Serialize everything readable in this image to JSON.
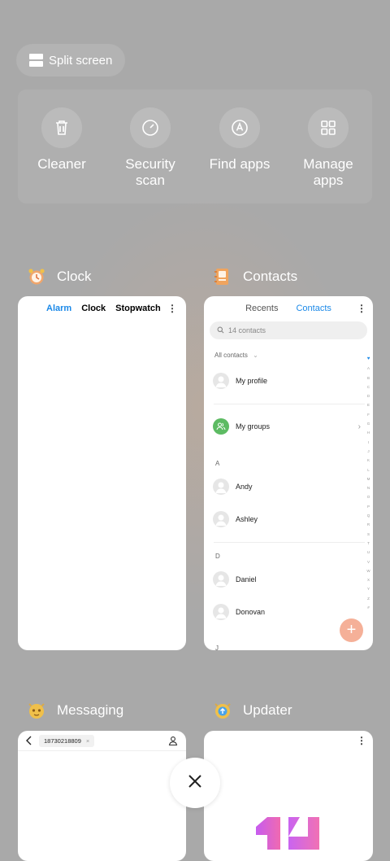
{
  "split_screen": {
    "label": "Split screen",
    "icon": "split-screen-icon"
  },
  "tools": [
    {
      "label": "Cleaner",
      "icon": "trash-icon"
    },
    {
      "label": "Security scan",
      "icon": "security-gauge-icon"
    },
    {
      "label": "Find apps",
      "icon": "find-apps-icon"
    },
    {
      "label": "Manage apps",
      "icon": "grid-icon"
    }
  ],
  "apps": {
    "clock": {
      "name": "Clock",
      "icon": "alarm-clock-icon",
      "tabs": [
        "Alarm",
        "Clock",
        "Stopwatch"
      ],
      "active_tab": "Alarm"
    },
    "contacts": {
      "name": "Contacts",
      "icon": "contacts-book-icon",
      "tabs": [
        "Recents",
        "Contacts"
      ],
      "active_tab": "Contacts",
      "search_placeholder": "14 contacts",
      "filter": "All contacts",
      "my_profile": "My profile",
      "my_groups": "My groups",
      "sections": [
        {
          "letter": "A",
          "names": [
            "Andy",
            "Ashley"
          ]
        },
        {
          "letter": "D",
          "names": [
            "Daniel",
            "Donovan"
          ]
        }
      ],
      "next_letter": "J",
      "index": [
        "A",
        "B",
        "C",
        "D",
        "E",
        "F",
        "G",
        "H",
        "I",
        "J",
        "K",
        "L",
        "M",
        "N",
        "O",
        "P",
        "Q",
        "R",
        "S",
        "T",
        "U",
        "V",
        "W",
        "X",
        "Y",
        "Z",
        "#"
      ]
    },
    "messaging": {
      "name": "Messaging",
      "icon": "messaging-cat-icon",
      "recipient": "18730218809"
    },
    "updater": {
      "name": "Updater",
      "icon": "updater-icon"
    }
  },
  "colors": {
    "accent": "#1b89e8",
    "background": "#a9a9a9",
    "fab": "#f5b098",
    "groups": "#5dbb63"
  }
}
